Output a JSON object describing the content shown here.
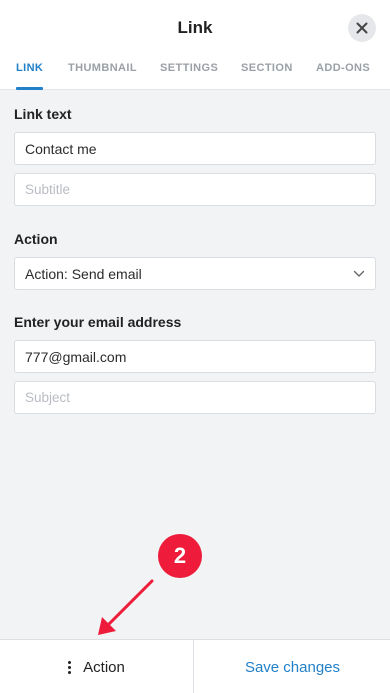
{
  "header": {
    "title": "Link"
  },
  "tabs": [
    {
      "label": "LINK",
      "active": true
    },
    {
      "label": "THUMBNAIL",
      "active": false
    },
    {
      "label": "SETTINGS",
      "active": false
    },
    {
      "label": "SECTION",
      "active": false
    },
    {
      "label": "ADD-ONS",
      "active": false
    }
  ],
  "link_text": {
    "label": "Link text",
    "value": "Contact me",
    "subtitle_placeholder": "Subtitle"
  },
  "action": {
    "label": "Action",
    "selected": "Action: Send email"
  },
  "email": {
    "label": "Enter your email address",
    "value": "777@gmail.com",
    "subject_placeholder": "Subject"
  },
  "footer": {
    "action_label": "Action",
    "save_label": "Save changes"
  },
  "annotation": {
    "step_number": "2"
  },
  "colors": {
    "accent": "#2280c9",
    "annotation": "#ee1c3a",
    "background": "#f2f3f5"
  }
}
